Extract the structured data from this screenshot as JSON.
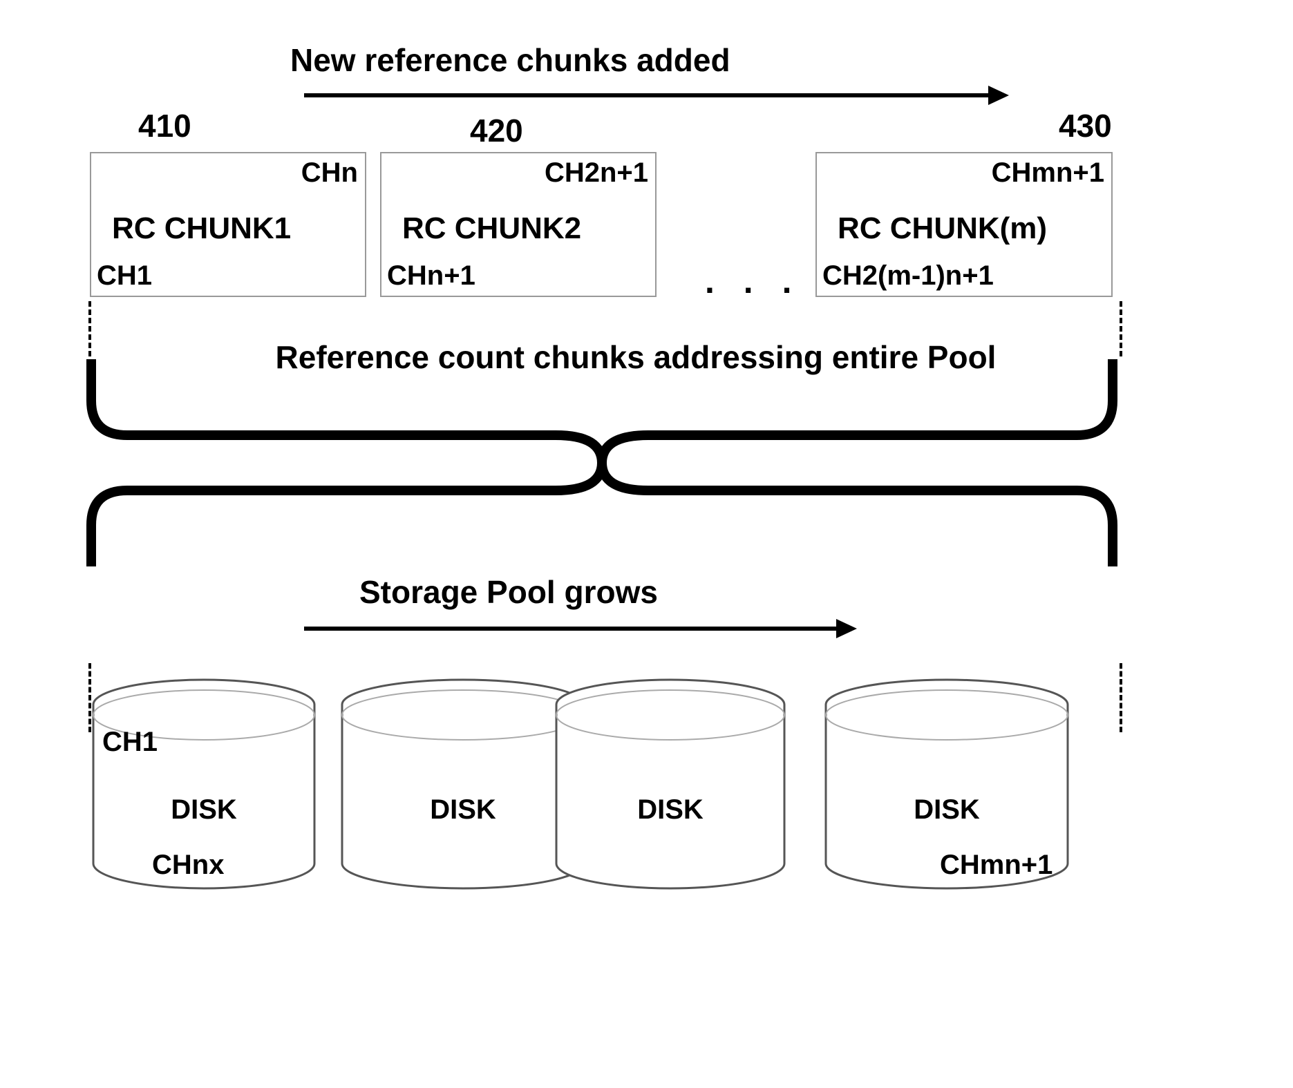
{
  "top_title": "New reference chunks added",
  "numbers": {
    "a": "410",
    "b": "420",
    "c": "430"
  },
  "chunks": [
    {
      "top_right": "CHn",
      "mid": "RC CHUNK1",
      "bottom_left": "CH1"
    },
    {
      "top_right": "CH2n+1",
      "mid": "RC CHUNK2",
      "bottom_left": "CHn+1"
    },
    {
      "top_right": "CHmn+1",
      "mid": "RC CHUNK(m)",
      "bottom_left": "CH2(m-1)n+1"
    }
  ],
  "ellipsis": ". . .",
  "mid_text": "Reference count chunks addressing entire Pool",
  "pool_title": "Storage Pool grows",
  "disks": [
    {
      "main": "DISK",
      "top_left": "CH1",
      "bottom": "CHnx"
    },
    {
      "main": "DISK"
    },
    {
      "main": "DISK"
    },
    {
      "main": "DISK",
      "bottom": "CHmn+1"
    }
  ]
}
